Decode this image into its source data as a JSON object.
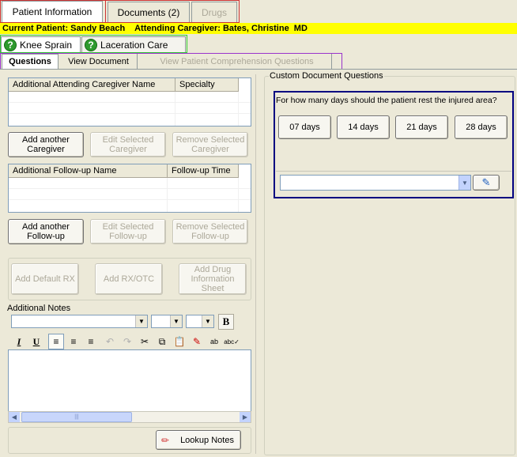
{
  "top_tabs": [
    {
      "label": "Patient Information"
    },
    {
      "label": "Documents (2)"
    },
    {
      "label": "Drugs"
    }
  ],
  "banner": {
    "patient": "Current Patient: Sandy Beach",
    "caregiver": "Attending Caregiver: Bates, Christine  MD"
  },
  "condition_tabs": [
    {
      "label": "Knee Sprain",
      "icon": "question-icon"
    },
    {
      "label": "Laceration Care",
      "icon": "question-icon"
    }
  ],
  "sub_tabs": [
    {
      "label": "Questions"
    },
    {
      "label": "View Document"
    },
    {
      "label": "View Patient Comprehension Questions"
    }
  ],
  "caregiver_grid": {
    "columns": [
      "Additional Attending Caregiver Name",
      "Specialty"
    ]
  },
  "caregiver_buttons": {
    "add": "Add another Caregiver",
    "edit": "Edit Selected Caregiver",
    "remove": "Remove Selected Caregiver"
  },
  "followup_grid": {
    "columns": [
      "Additional Follow-up Name",
      "Follow-up Time"
    ]
  },
  "followup_buttons": {
    "add": "Add another Follow-up",
    "edit": "Edit Selected Follow-up",
    "remove": "Remove Selected Follow-up"
  },
  "rx_buttons": {
    "default_rx": "Add Default RX",
    "rx_otc": "Add RX/OTC",
    "drug_sheet": "Add Drug Information Sheet"
  },
  "notes": {
    "label": "Additional Notes",
    "toolbar": {
      "bold": "B",
      "italic": "I",
      "underline": "U"
    },
    "lookup_button": "Lookup Notes"
  },
  "custom_questions": {
    "group_label": "Custom Document Questions",
    "question": "For how many days should the patient rest the injured area?",
    "answers": [
      "07 days",
      "14 days",
      "21 days",
      "28 days"
    ],
    "answer_value": ""
  },
  "colors": {
    "banner_bg": "#ffff00",
    "patient_tab_highlight": "#cc3333",
    "documents_tab_highlight": "#cc3333",
    "condition_tab_highlight": "#33cc33",
    "subtab_highlight": "#9933cc",
    "question_panel_border": "#000080"
  }
}
